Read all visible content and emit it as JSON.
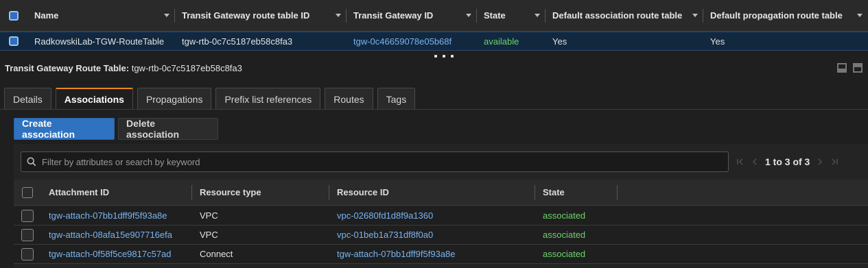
{
  "top_table": {
    "columns": [
      "Name",
      "Transit Gateway route table ID",
      "Transit Gateway ID",
      "State",
      "Default association route table",
      "Default propagation route table"
    ],
    "row": {
      "name": "RadkowskiLab-TGW-RouteTable",
      "route_table_id": "tgw-rtb-0c7c5187eb58c8fa3",
      "tgw_id": "tgw-0c46659078e05b68f",
      "state": "available",
      "default_association": "Yes",
      "default_propagation": "Yes"
    }
  },
  "detail": {
    "title_label": "Transit Gateway Route Table:",
    "title_value": "tgw-rtb-0c7c5187eb58c8fa3",
    "tabs": [
      "Details",
      "Associations",
      "Propagations",
      "Prefix list references",
      "Routes",
      "Tags"
    ],
    "active_tab": "Associations",
    "create_button": "Create association",
    "delete_button": "Delete association",
    "search_placeholder": "Filter by attributes or search by keyword",
    "pager_text": "1 to 3 of 3",
    "list_columns": [
      "Attachment ID",
      "Resource type",
      "Resource ID",
      "State"
    ],
    "rows": [
      {
        "attachment_id": "tgw-attach-07bb1dff9f5f93a8e",
        "resource_type": "VPC",
        "resource_id": "vpc-02680fd1d8f9a1360",
        "state": "associated"
      },
      {
        "attachment_id": "tgw-attach-08afa15e907716efa",
        "resource_type": "VPC",
        "resource_id": "vpc-01beb1a731df8f0a0",
        "state": "associated"
      },
      {
        "attachment_id": "tgw-attach-0f58f5ce9817c57ad",
        "resource_type": "Connect",
        "resource_id": "tgw-attach-07bb1dff9f5f93a8e",
        "state": "associated"
      }
    ]
  },
  "colors": {
    "link": "#79b4f2",
    "status_green": "#6ad36a",
    "primary_button": "#2e72c0",
    "active_tab_accent": "#e8891c",
    "selected_row": "#12283f"
  },
  "icons": [
    "search-icon",
    "chevron-down-icon",
    "first-page-icon",
    "prev-page-icon",
    "next-page-icon",
    "last-page-icon",
    "minimize-icon",
    "maximize-icon"
  ]
}
